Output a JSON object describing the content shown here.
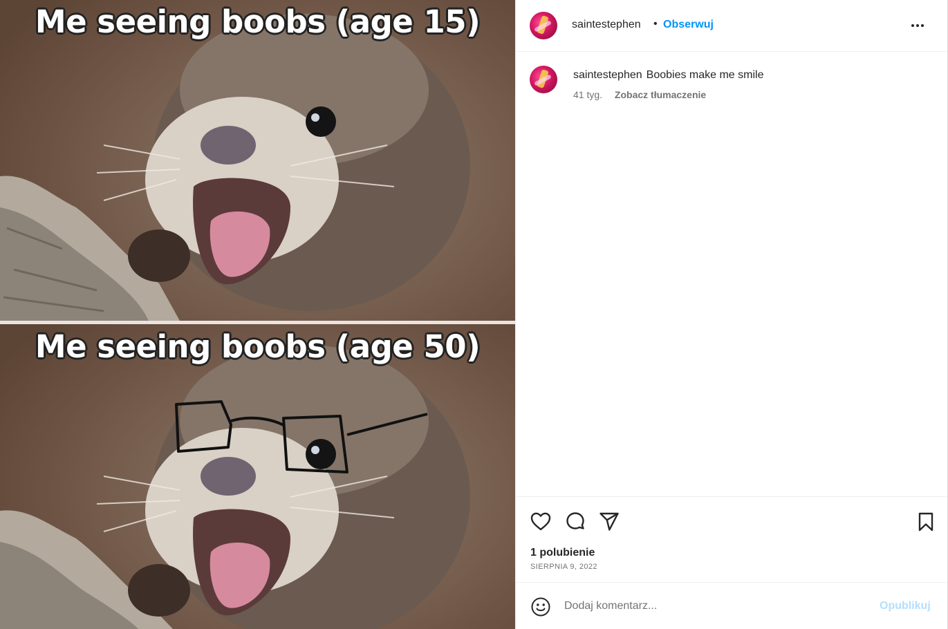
{
  "media": {
    "top_caption": "Me seeing boobs (age 15)",
    "bottom_caption": "Me seeing boobs (age 50)"
  },
  "header": {
    "username": "saintestephen",
    "separator": "•",
    "follow_label": "Obserwuj",
    "more_icon": "more-horizontal-icon"
  },
  "post_caption": {
    "username": "saintestephen",
    "text": "Boobies make me smile",
    "time_ago": "41 tyg.",
    "translate_label": "Zobacz tłumaczenie"
  },
  "actions": {
    "like_icon": "heart-icon",
    "comment_icon": "comment-bubble-icon",
    "share_icon": "paper-plane-icon",
    "save_icon": "bookmark-icon",
    "likes_text": "1 polubienie",
    "date_text": "SIERPNIA 9, 2022"
  },
  "comment_box": {
    "emoji_icon": "smiley-icon",
    "placeholder": "Dodaj komentarz...",
    "value": "",
    "publish_label": "Opublikuj"
  },
  "colors": {
    "accent": "#0095f6",
    "publish_disabled": "#b2dffc",
    "secondary_text": "#737373"
  }
}
